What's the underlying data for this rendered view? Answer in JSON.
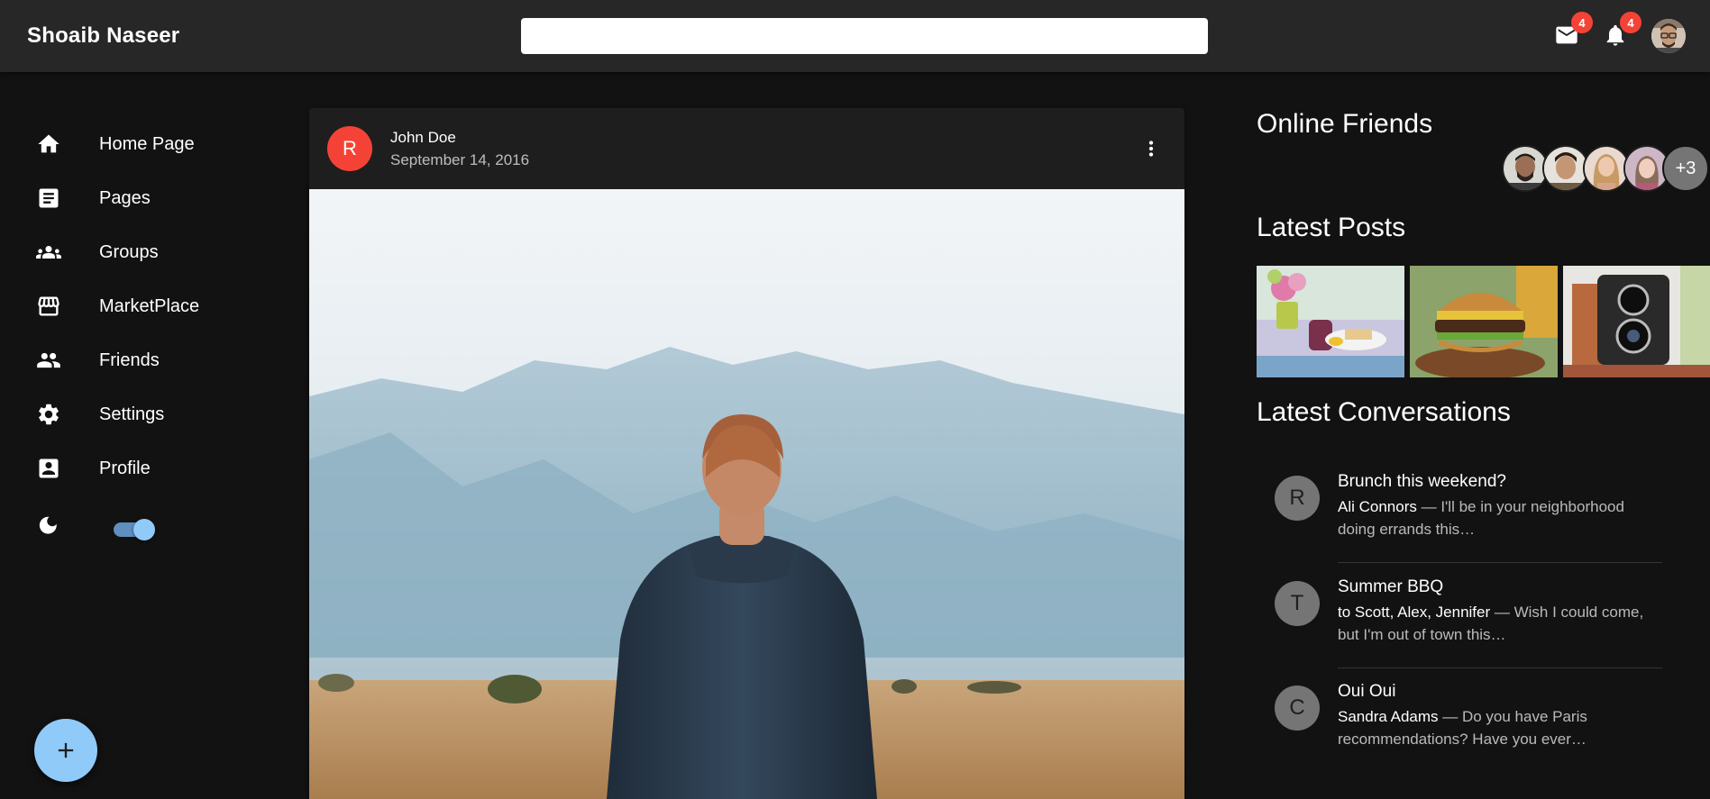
{
  "header": {
    "brand": "Shoaib Naseer",
    "search_placeholder": "",
    "mail_badge": "4",
    "notifications_badge": "4"
  },
  "sidebar": {
    "items": [
      {
        "label": "Home Page",
        "icon": "home-icon"
      },
      {
        "label": "Pages",
        "icon": "article-icon"
      },
      {
        "label": "Groups",
        "icon": "groups-icon"
      },
      {
        "label": "MarketPlace",
        "icon": "storefront-icon"
      },
      {
        "label": "Friends",
        "icon": "people-icon"
      },
      {
        "label": "Settings",
        "icon": "settings-icon"
      },
      {
        "label": "Profile",
        "icon": "account-box-icon"
      }
    ],
    "dark_mode_on": true
  },
  "post": {
    "avatar_letter": "R",
    "author": "John Doe",
    "date": "September 14, 2016"
  },
  "right": {
    "online_friends_title": "Online Friends",
    "friends_more": "+3",
    "latest_posts_title": "Latest Posts",
    "latest_conversations_title": "Latest Conversations",
    "conversations": [
      {
        "letter": "R",
        "title": "Brunch this weekend?",
        "from": "Ali Connors",
        "text": " — I'll be in your neighborhood doing errands this…"
      },
      {
        "letter": "T",
        "title": "Summer BBQ",
        "from": "to Scott, Alex, Jennifer",
        "text": " — Wish I could come, but I'm out of town this…"
      },
      {
        "letter": "C",
        "title": "Oui Oui",
        "from": "Sandra Adams",
        "text": " — Do you have Paris recommendations? Have you ever…"
      }
    ]
  },
  "colors": {
    "background": "#121212",
    "appbar": "#272727",
    "card": "#1e1e1e",
    "accent": "#90caf9",
    "badge": "#f44336",
    "post_avatar": "#f44336"
  }
}
